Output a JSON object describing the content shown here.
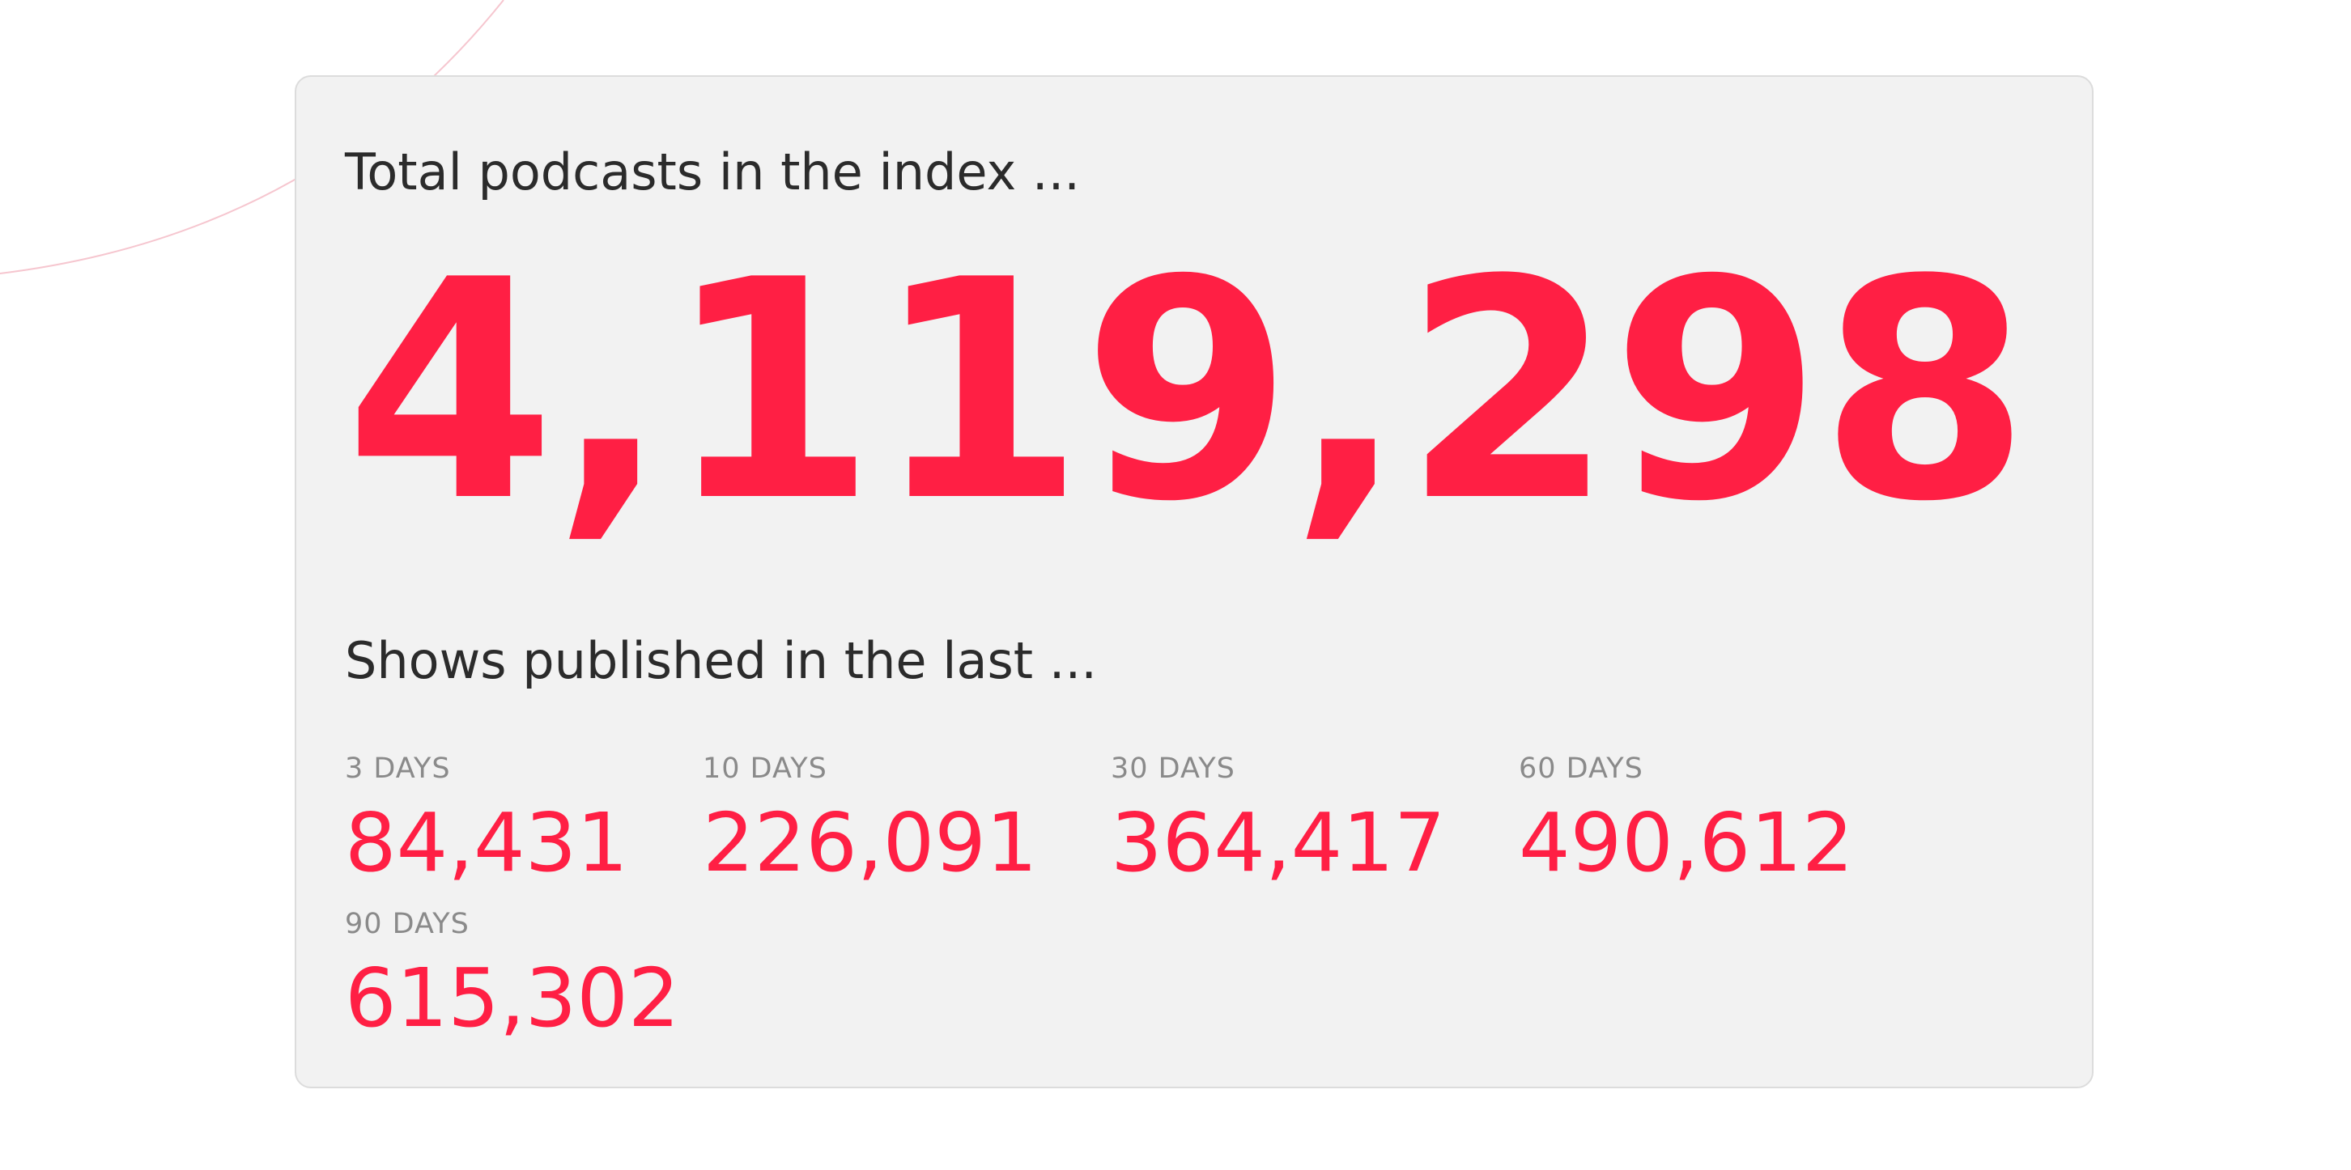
{
  "colors": {
    "accent": "#ff1f44",
    "card_background": "#f2f2f2",
    "card_border": "#dcdcdc",
    "heading_text": "#2b2b2b",
    "label_text": "#8a8a8a",
    "page_background": "#ffffff"
  },
  "total": {
    "heading": "Total podcasts in the index ...",
    "value": "4,119,298"
  },
  "recent": {
    "heading": "Shows published in the last ...",
    "periods": [
      {
        "label": "3 DAYS",
        "value": "84,431"
      },
      {
        "label": "10 DAYS",
        "value": "226,091"
      },
      {
        "label": "30 DAYS",
        "value": "364,417"
      },
      {
        "label": "60 DAYS",
        "value": "490,612"
      },
      {
        "label": "90 DAYS",
        "value": "615,302"
      }
    ]
  }
}
